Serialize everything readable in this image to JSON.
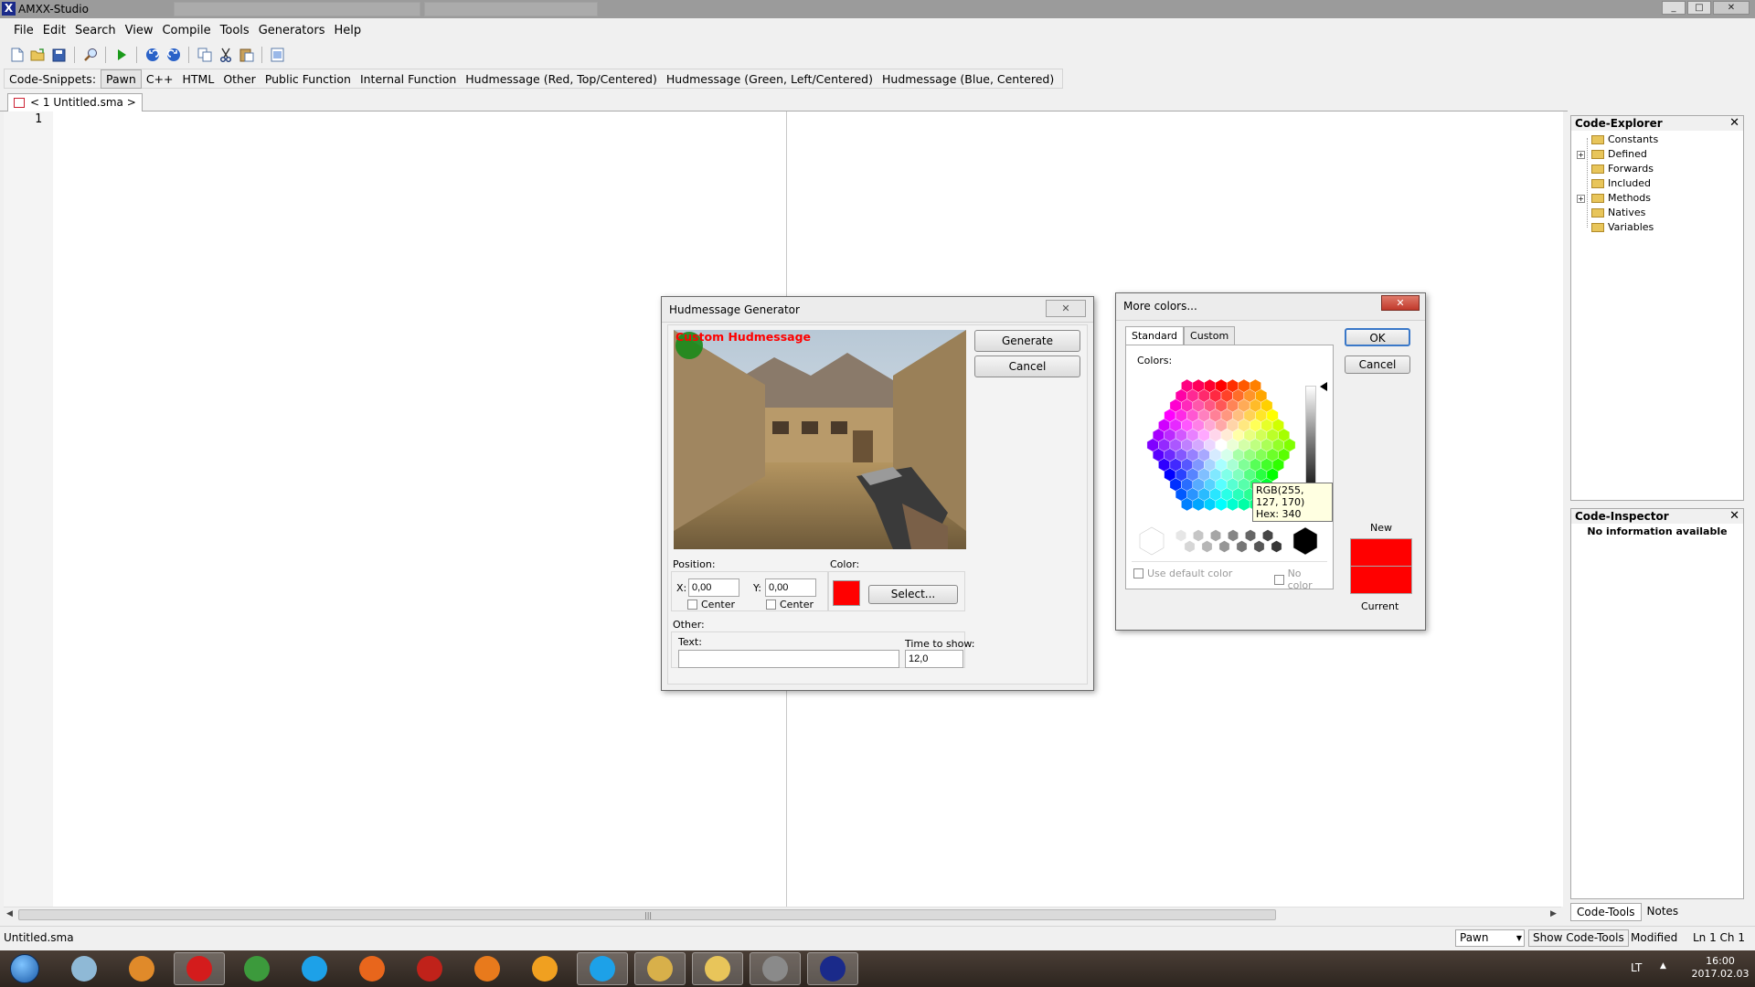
{
  "window": {
    "title": "AMXX-Studio",
    "minimize": "_",
    "maximize": "□",
    "close": "✕"
  },
  "menu": [
    "File",
    "Edit",
    "Search",
    "View",
    "Compile",
    "Tools",
    "Generators",
    "Help"
  ],
  "toolbar": [
    "new-file-icon",
    "open-folder-icon",
    "save-icon",
    "search-icon",
    "run-icon",
    "undo-icon",
    "redo-icon",
    "copy-icon",
    "cut-icon",
    "paste-icon",
    "select-all-icon"
  ],
  "snippets": {
    "label": "Code-Snippets:",
    "items": [
      "Pawn",
      "C++",
      "HTML",
      "Other",
      "Public Function",
      "Internal Function",
      "Hudmessage (Red, Top/Centered)",
      "Hudmessage (Green, Left/Centered)",
      "Hudmessage (Blue, Centered)"
    ],
    "active": "Pawn"
  },
  "document_tab": {
    "label": "< 1 Untitled.sma >"
  },
  "editor": {
    "line_number": "1",
    "scroll_grip": "|||"
  },
  "code_explorer": {
    "title": "Code-Explorer",
    "close": "✕",
    "items": [
      {
        "label": "Constants",
        "expandable": false
      },
      {
        "label": "Defined",
        "expandable": true
      },
      {
        "label": "Forwards",
        "expandable": false
      },
      {
        "label": "Included",
        "expandable": false
      },
      {
        "label": "Methods",
        "expandable": true
      },
      {
        "label": "Natives",
        "expandable": false
      },
      {
        "label": "Variables",
        "expandable": false
      }
    ],
    "expander_symbol": "+"
  },
  "code_inspector": {
    "title": "Code-Inspector",
    "close": "✕",
    "message": "No information available"
  },
  "bottom_tabs": [
    "Code-Tools",
    "Notes"
  ],
  "statusbar": {
    "file": "Untitled.sma",
    "language": "Pawn",
    "show_code_tools": "Show Code-Tools",
    "modified": "Modified",
    "position": "Ln 1 Ch 1"
  },
  "taskbar": {
    "tray_lang": "LT",
    "tray_arrow": "▲",
    "time": "16:00",
    "date": "2017.02.03",
    "apps": [
      {
        "name": "notepad-app-icon",
        "color": "#8fb9d6"
      },
      {
        "name": "blender-app-icon",
        "color": "#e08a2a"
      },
      {
        "name": "opera-app-icon",
        "color": "#d41c1c"
      },
      {
        "name": "chrome-app-icon",
        "color": "#3c9a3c"
      },
      {
        "name": "skype-app-icon",
        "color": "#1da1e8"
      },
      {
        "name": "firefox-app-icon",
        "color": "#e8661c"
      },
      {
        "name": "game-app-icon",
        "color": "#c0221a"
      },
      {
        "name": "half-life-app-icon",
        "color": "#e87a1c"
      },
      {
        "name": "media-player-app-icon",
        "color": "#f0a020"
      },
      {
        "name": "skype-busy-app-icon",
        "color": "#1da1e8"
      },
      {
        "name": "lock-app-icon",
        "color": "#d8b04a"
      },
      {
        "name": "explorer-app-icon",
        "color": "#e8c55a"
      },
      {
        "name": "tools-app-icon",
        "color": "#8a8a8a"
      },
      {
        "name": "amxx-studio-app-icon",
        "color": "#1a2a8a"
      }
    ]
  },
  "hud_dialog": {
    "title": "Hudmessage Generator",
    "close": "✕",
    "preview_text": "Custom Hudmessage",
    "generate": "Generate",
    "cancel": "Cancel",
    "position_label": "Position:",
    "x_label": "X:",
    "x_value": "0,00",
    "y_label": "Y:",
    "y_value": "0,00",
    "center_label": "Center",
    "color_label": "Color:",
    "select_button": "Select...",
    "other_label": "Other:",
    "text_label": "Text:",
    "text_value": "",
    "time_label": "Time to show:",
    "time_value": "12,0",
    "text_color": "#ff0000"
  },
  "colors_dialog": {
    "title": "More colors...",
    "close": "✕",
    "tabs": [
      "Standard",
      "Custom"
    ],
    "colors_label": "Colors:",
    "ok": "OK",
    "cancel": "Cancel",
    "tooltip_rgb": "RGB(255, 127, 170)",
    "tooltip_hex": "Hex: 340",
    "use_default": "Use default color",
    "no_color": "No color",
    "new_label": "New",
    "current_label": "Current",
    "new_color": "#ff0000",
    "current_color": "#ff0000"
  }
}
